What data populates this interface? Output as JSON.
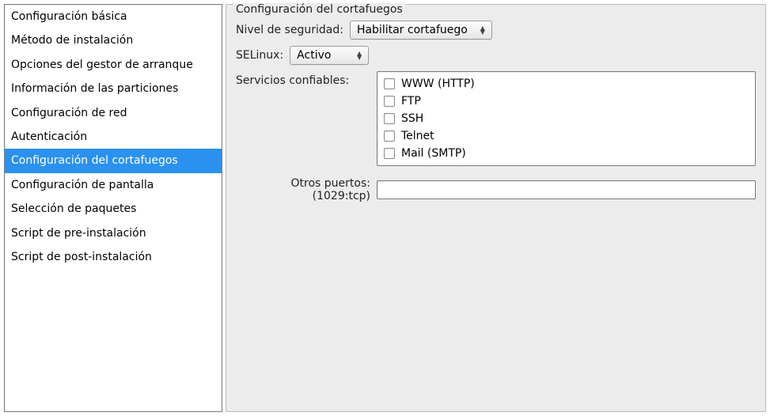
{
  "sidebar": {
    "items": [
      {
        "label": "Configuración básica"
      },
      {
        "label": "Método de instalación"
      },
      {
        "label": "Opciones del gestor de arranque"
      },
      {
        "label": "Información de las particiones"
      },
      {
        "label": "Configuración de red"
      },
      {
        "label": "Autenticación"
      },
      {
        "label": "Configuración del cortafuegos",
        "selected": true
      },
      {
        "label": "Configuración de pantalla"
      },
      {
        "label": "Selección de paquetes"
      },
      {
        "label": "Script de pre-instalación"
      },
      {
        "label": "Script de post-instalación"
      }
    ]
  },
  "panel": {
    "title": "Configuración del cortafuegos",
    "security_level_label": "Nivel de seguridad:",
    "security_level_value": "Habilitar cortafuego",
    "selinux_label": "SELinux:",
    "selinux_value": "Activo",
    "trusted_services_label": "Servicios confiables:",
    "trusted_services": [
      {
        "label": "WWW (HTTP)",
        "checked": false
      },
      {
        "label": "FTP",
        "checked": false
      },
      {
        "label": "SSH",
        "checked": false
      },
      {
        "label": "Telnet",
        "checked": false
      },
      {
        "label": "Mail (SMTP)",
        "checked": false
      }
    ],
    "other_ports_label": "Otros puertos: (1029:tcp)",
    "other_ports_value": ""
  }
}
